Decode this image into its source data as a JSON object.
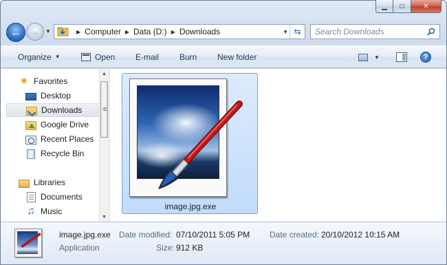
{
  "window": {
    "caption": {
      "minimize": "▁",
      "maximize": "□",
      "close": "✕"
    }
  },
  "nav": {
    "back_glyph": "←",
    "forward_glyph": "→",
    "recent_glyph": "▼"
  },
  "address": {
    "crumbs": [
      "Computer",
      "Data (D:)",
      "Downloads"
    ],
    "separator": "▶",
    "dropdown_glyph": "▼",
    "refresh_glyph": "⇆"
  },
  "search": {
    "placeholder": "Search Downloads"
  },
  "toolbar": {
    "organize": "Organize",
    "caret": "▼",
    "open": "Open",
    "email": "E-mail",
    "burn": "Burn",
    "new_folder": "New folder",
    "help": "?"
  },
  "navpane": {
    "favorites_header": "Favorites",
    "favorites": [
      "Desktop",
      "Downloads",
      "Google Drive",
      "Recent Places",
      "Recycle Bin"
    ],
    "selected": "Downloads",
    "libraries_header": "Libraries",
    "libraries": [
      "Documents",
      "Music"
    ],
    "scroll_up": "▲",
    "scroll_down": "▼"
  },
  "content": {
    "files": [
      {
        "name": "image.jpg.exe",
        "selected": true
      }
    ]
  },
  "details": {
    "name": "image.jpg.exe",
    "type": "Application",
    "date_modified_label": "Date modified:",
    "date_modified": "07/10/2011 5:05 PM",
    "date_created_label": "Date created:",
    "date_created": "20/10/2012 10:15 AM",
    "size_label": "Size:",
    "size": "912 KB"
  },
  "colors": {
    "frame": "#cfdcec",
    "selection": "#c1dcfc",
    "selection_border": "#7da2ce",
    "brush_red": "#c21a1a"
  },
  "icons": {
    "favorites": "star-icon",
    "desktop": "desktop-icon",
    "downloads": "downloads-folder-icon",
    "google_drive": "google-drive-icon",
    "recent_places": "recent-places-icon",
    "recycle_bin": "recycle-bin-icon",
    "libraries": "libraries-icon",
    "documents": "documents-icon",
    "music": "music-icon"
  }
}
